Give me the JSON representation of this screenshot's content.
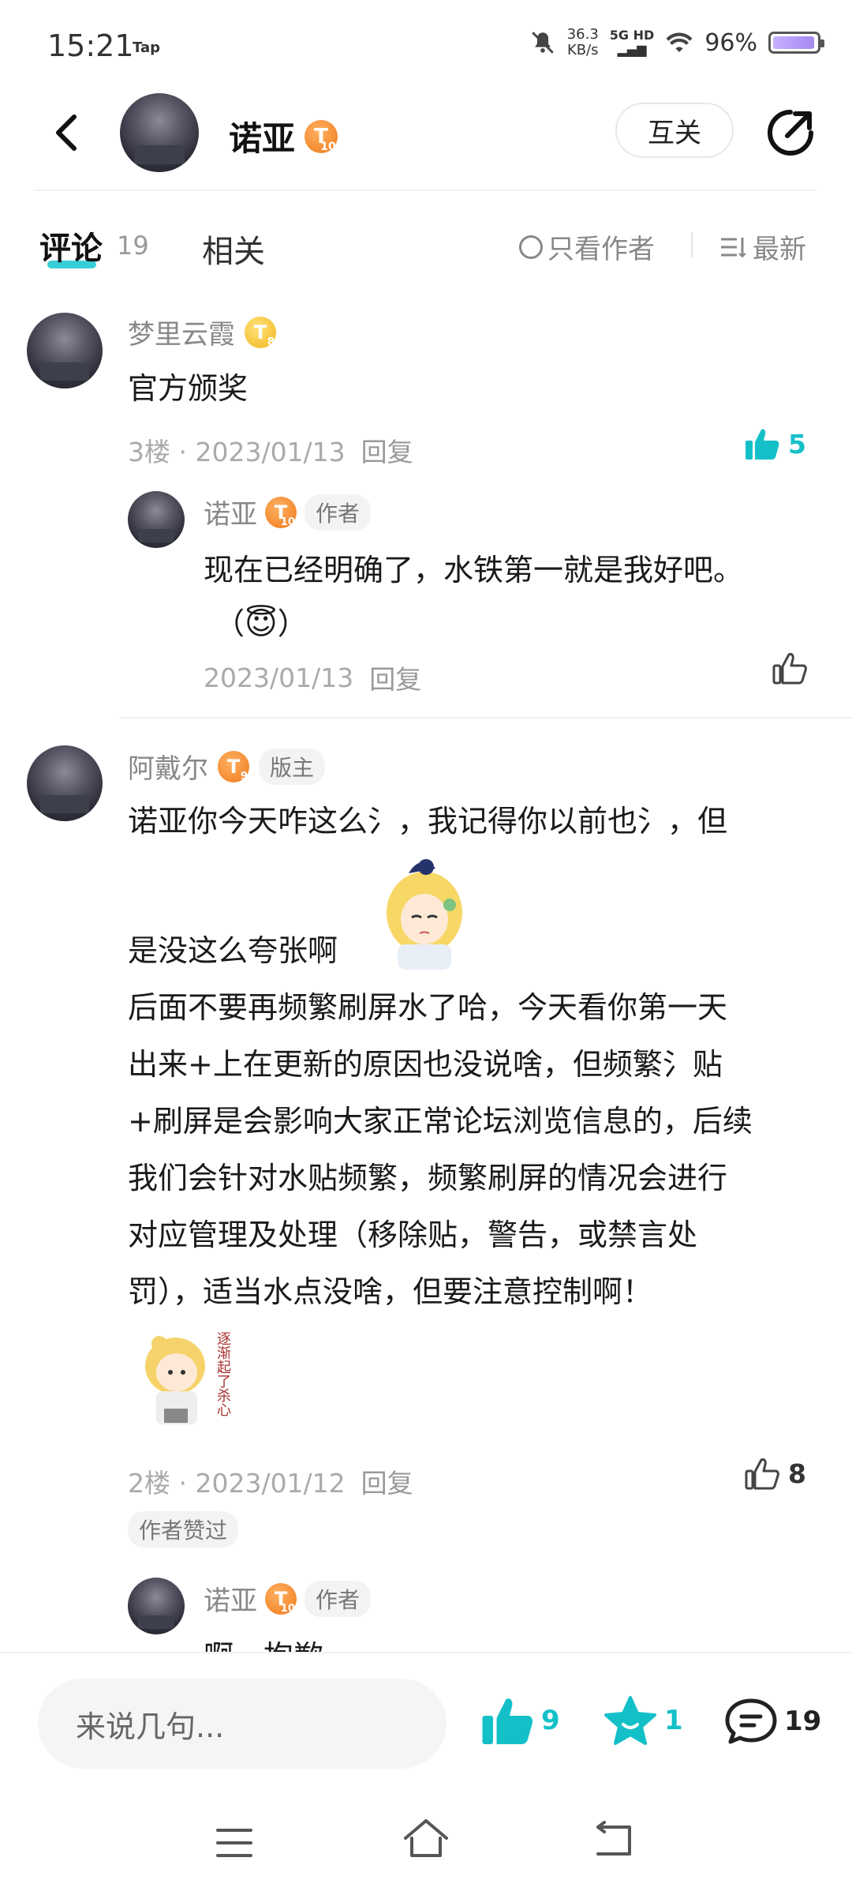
{
  "status_bar": {
    "time": "15:21",
    "app_tag": "Tap",
    "net_speed_value": "36.3",
    "net_speed_unit": "KB/s",
    "network": "5G HD",
    "battery_pct": "96%",
    "battery_level": 0.96
  },
  "header": {
    "username": "诺亚",
    "level": "T",
    "level_num": "10",
    "follow_label": "互关"
  },
  "tabs": {
    "comments_label": "评论",
    "comments_count": "19",
    "related_label": "相关",
    "only_author_label": "只看作者",
    "sort_label": "最新"
  },
  "comments": [
    {
      "username": "梦里云霞",
      "level": "T",
      "level_num": "8",
      "text": "官方颁奖",
      "floor": "3楼 · 2023/01/13",
      "reply_label": "回复",
      "likes": "5",
      "replies": [
        {
          "username": "诺亚",
          "level": "T",
          "level_num": "10",
          "badge": "作者",
          "text_line1": "现在已经明确了，水铁第一就是我好吧。",
          "text_line2_prefix": "（",
          "text_line2_emoji": "😇",
          "text_line2_suffix": "）",
          "date": "2023/01/13",
          "reply_label": "回复"
        }
      ]
    },
    {
      "username": "阿戴尔",
      "level": "T",
      "level_num": "9",
      "badge": "版主",
      "text_line1": "诺亚你今天咋这么氵，我记得你以前也氵，但",
      "text_line2": "是没这么夸张啊",
      "text_para2_lines": [
        "后面不要再频繁刷屏水了哈，今天看你第一天",
        "出来+上在更新的原因也没说啥，但频繁氵贴",
        "+刷屏是会影响大家正常论坛浏览信息的，后续",
        "我们会针对水贴频繁，频繁刷屏的情况会进行",
        "对应管理及处理（移除贴，警告，或禁言处",
        "罚），适当水点没啥，但要注意控制啊！"
      ],
      "sticker_text": "逐渐起了杀心",
      "floor": "2楼 · 2023/01/12",
      "reply_label": "回复",
      "likes": "8",
      "author_liked": "作者赞过",
      "replies": [
        {
          "username": "诺亚",
          "level": "T",
          "level_num": "10",
          "badge": "作者",
          "text_partial": "啊，抱歉"
        }
      ]
    }
  ],
  "bottom_bar": {
    "input_placeholder": "来说几句...",
    "likes": "9",
    "favorites": "1",
    "comments": "19"
  },
  "colors": {
    "accent": "#14c0c8",
    "level_orange": "#f07a1c",
    "level_gold": "#f0b51c"
  },
  "icons": [
    "back-icon",
    "share-icon",
    "thumbs-up-icon",
    "star-icon",
    "comment-icon",
    "menu-icon",
    "home-icon",
    "return-icon",
    "sort-icon"
  ]
}
